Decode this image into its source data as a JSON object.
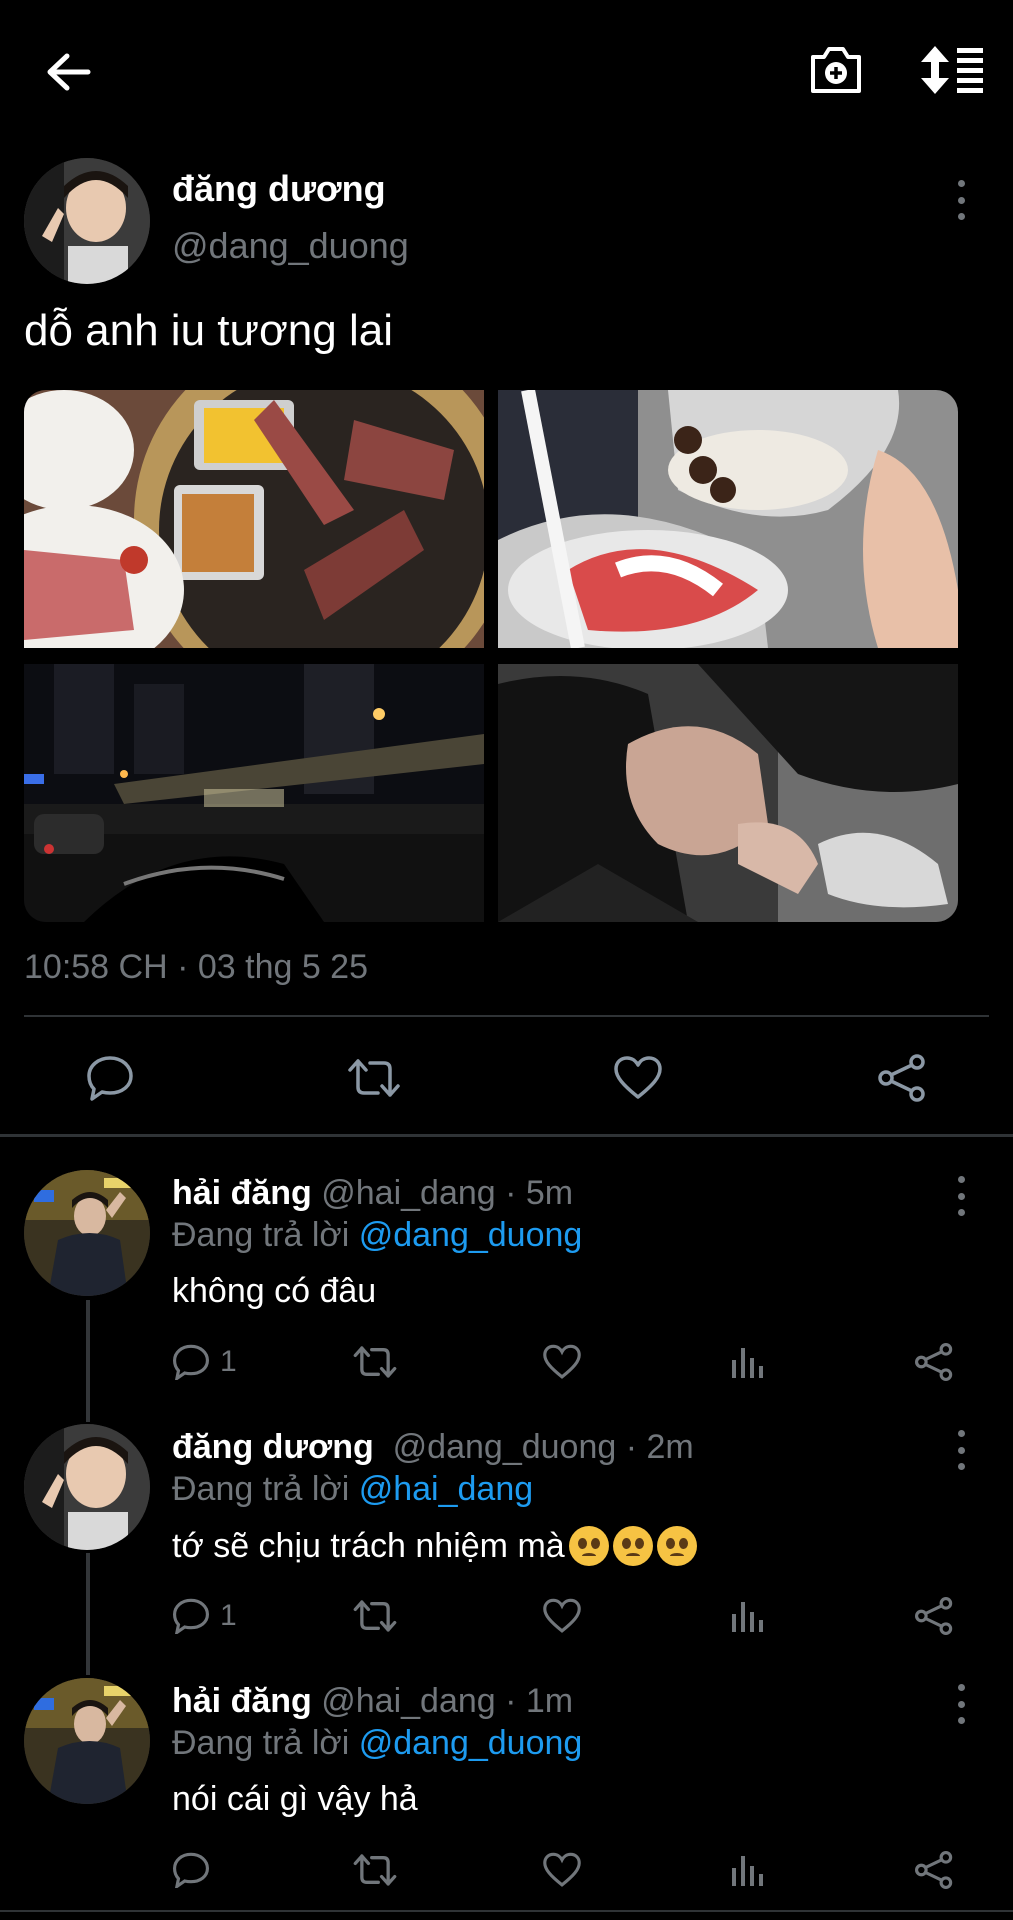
{
  "main_tweet": {
    "author_name": "đăng dương",
    "author_handle": "@dang_duong",
    "text": "dỗ anh iu tương lai",
    "timestamp": "10:58 CH · 03 thg 5 25"
  },
  "replies": [
    {
      "name": "hải đăng",
      "meta": "@hai_dang · 5m",
      "replying_prefix": "Đang trả lời ",
      "replying_to": "@dang_duong",
      "text": "không có đâu",
      "reply_count": "1"
    },
    {
      "name": "đăng dương",
      "meta": "@dang_duong · 2m",
      "replying_prefix": "Đang trả lời ",
      "replying_to": "@hai_dang",
      "text": "tớ sẽ chịu trách nhiệm mà",
      "reply_count": "1"
    },
    {
      "name": "hải đăng",
      "meta": "@hai_dang · 1m",
      "replying_prefix": "Đang trả lời ",
      "replying_to": "@dang_duong",
      "text": "nói cái gì vậy hả",
      "reply_count": ""
    }
  ],
  "icons": {
    "back": "arrow-left-icon",
    "camera": "camera-plus-icon",
    "sort": "sort-icon",
    "more": "more-vertical-icon",
    "reply": "reply-icon",
    "retweet": "retweet-icon",
    "like": "heart-icon",
    "views": "views-icon",
    "share": "share-icon"
  },
  "colors": {
    "background": "#000000",
    "text": "#e7e9ea",
    "secondary": "#71767b",
    "link": "#1d9bf0",
    "divider": "#2f3336"
  }
}
